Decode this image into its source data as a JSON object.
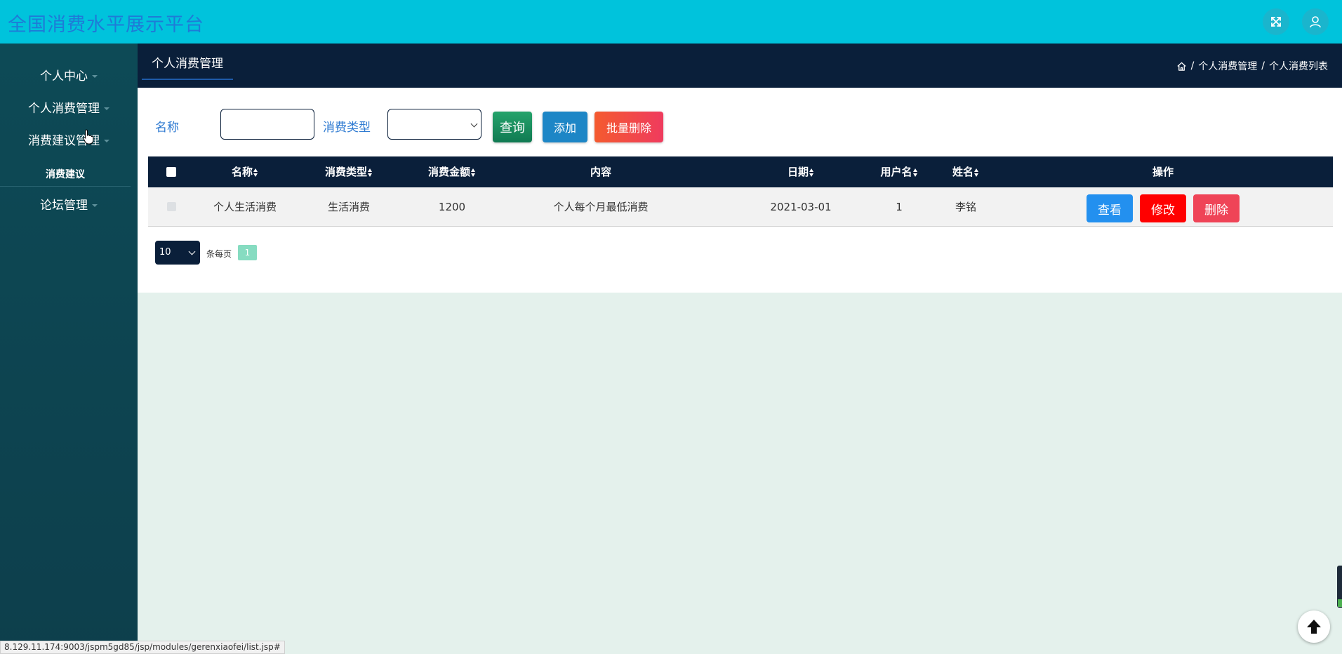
{
  "app": {
    "title": "全国消费水平展示平台"
  },
  "topbar": {
    "fullscreen_icon": "expand-arrows-icon",
    "user_icon": "user-icon"
  },
  "sidebar": {
    "items": [
      {
        "label": "个人中心"
      },
      {
        "label": "个人消费管理"
      },
      {
        "label": "消费建议管理"
      },
      {
        "label": "论坛管理"
      }
    ],
    "subitem": {
      "label": "消费建议"
    }
  },
  "header": {
    "section_tab": "个人消费管理",
    "breadcrumb": {
      "home_icon": "home-icon",
      "sep1": "/",
      "item1": "个人消费管理",
      "sep2": "/",
      "item2": "个人消费列表"
    }
  },
  "search": {
    "name_label": "名称",
    "name_value": "",
    "type_label": "消费类型",
    "type_value": "",
    "query_button": "查询",
    "add_button": "添加",
    "batch_delete_button": "批量删除"
  },
  "table": {
    "headers": {
      "name": "名称",
      "type": "消费类型",
      "amount": "消费金额",
      "content": "内容",
      "date": "日期",
      "username": "用户名",
      "fullname": "姓名",
      "actions": "操作"
    },
    "rows": [
      {
        "name": "个人生活消费",
        "type": "生活消费",
        "amount": "1200",
        "content": "个人每个月最低消费",
        "date": "2021-03-01",
        "username": "1",
        "fullname": "李铭",
        "view": "查看",
        "edit": "修改",
        "delete": "删除"
      }
    ]
  },
  "pagination": {
    "page_size": "10",
    "per_page_label": "条每页",
    "current_page": "1"
  },
  "status_bar": {
    "url": "8.129.11.174:9003/jspm5gd85/jsp/modules/gerenxiaofei/list.jsp#"
  },
  "colors": {
    "topbar": "#00c3dc",
    "sidebar": "#0d4a56",
    "header": "#0a1f3a",
    "accent_blue": "#2e7ad1",
    "query_green": "#107a52",
    "danger_red": "#ff0000"
  }
}
